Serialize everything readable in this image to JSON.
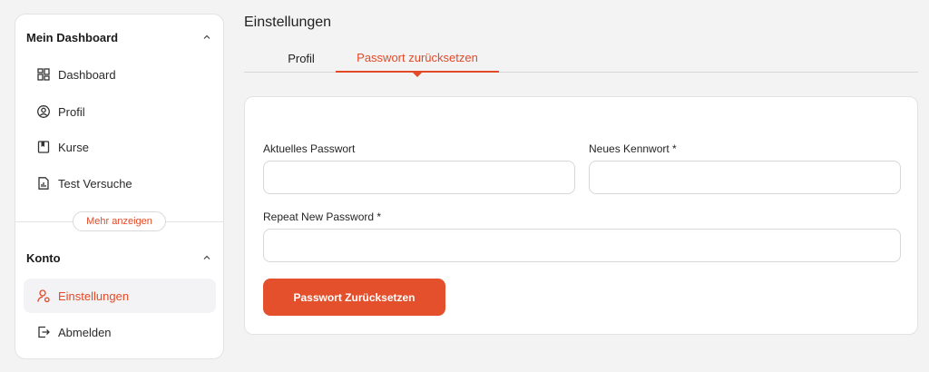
{
  "sidebar": {
    "section_dashboard": {
      "title": "Mein Dashboard",
      "items": [
        {
          "label": "Dashboard",
          "icon": "dashboard-grid-icon"
        },
        {
          "label": "Profil",
          "icon": "user-circle-icon"
        },
        {
          "label": "Kurse",
          "icon": "book-icon"
        },
        {
          "label": "Test Versuche",
          "icon": "report-chart-icon"
        }
      ],
      "more_label": "Mehr anzeigen"
    },
    "section_konto": {
      "title": "Konto",
      "items": [
        {
          "label": "Einstellungen",
          "icon": "user-settings-icon",
          "active": true
        },
        {
          "label": "Abmelden",
          "icon": "logout-icon"
        }
      ]
    }
  },
  "main": {
    "title": "Einstellungen",
    "tabs": [
      {
        "label": "Profil",
        "active": false
      },
      {
        "label": "Passwort zurücksetzen",
        "active": true
      }
    ],
    "form": {
      "current_password_label": "Aktuelles Passwort",
      "current_password_value": "",
      "new_password_label": "Neues Kennwort *",
      "new_password_value": "",
      "repeat_password_label": "Repeat New Password *",
      "repeat_password_value": "",
      "submit_label": "Passwort Zurücksetzen"
    }
  },
  "colors": {
    "accent": "#e24a28",
    "button": "#e4502c",
    "background": "#f3f3f4",
    "active_item_bg": "#f3f3f5"
  }
}
